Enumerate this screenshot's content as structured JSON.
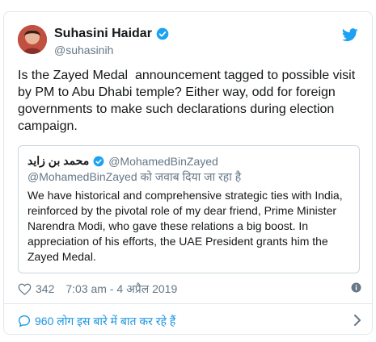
{
  "author": {
    "name": "Suhasini Haidar",
    "handle": "@suhasinih"
  },
  "tweet": {
    "text": "Is the Zayed Medal  announcement tagged to possible visit by PM to Abu Dhabi temple? Either way, odd for foreign governments to make such declarations during election campaign."
  },
  "quoted": {
    "name": "محمد بن زايد",
    "handle": "@MohamedBinZayed",
    "reply_context": "@MohamedBinZayed को जवाब दिया जा रहा है",
    "text": "We have historical and comprehensive strategic ties with India, reinforced by the pivotal role of my dear friend, Prime Minister Narendra Modi, who gave these relations a big boost. In appreciation of his efforts, the UAE President grants him the Zayed Medal."
  },
  "meta": {
    "likes": "342",
    "timestamp": "7:03 am - 4 अप्रैल 2019"
  },
  "replies": {
    "label": "960 लोग इस बारे में बात कर रहे हैं"
  },
  "colors": {
    "twitter_blue": "#1da1f2",
    "link_blue": "#1b95e0",
    "secondary_text": "#657786",
    "border": "#e1e8ed"
  },
  "icons": [
    "twitter-bird-icon",
    "verified-badge-icon",
    "heart-icon",
    "info-icon",
    "reply-bubble-icon",
    "chevron-right-icon"
  ]
}
